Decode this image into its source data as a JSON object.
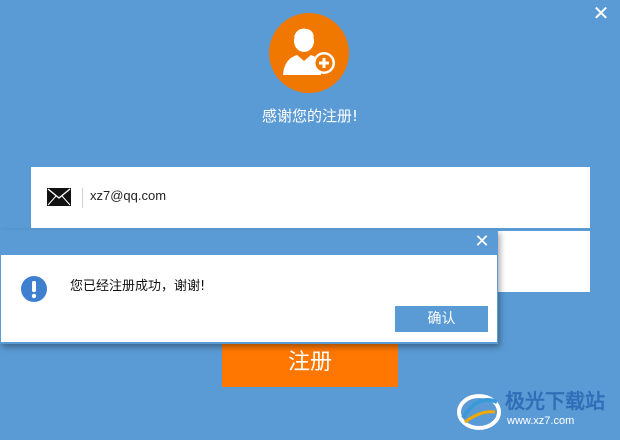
{
  "window": {
    "close_glyph": "✕",
    "title": "感谢您的注册!"
  },
  "icons": {
    "avatar": "user-add-icon",
    "mail": "mail-icon",
    "info": "info-icon",
    "close": "close-icon"
  },
  "colors": {
    "background": "#5b9bd5",
    "accent_orange": "#ff7700",
    "avatar_orange": "#f07800",
    "field_bg": "#ffffff"
  },
  "form": {
    "email_value": "xz7@qq.com",
    "register_label": "注册"
  },
  "dialog": {
    "close_glyph": "✕",
    "message": "您已经注册成功，谢谢!",
    "confirm_label": "确认"
  },
  "watermark": {
    "name": "极光下载站",
    "url": "www.xz7.com"
  }
}
